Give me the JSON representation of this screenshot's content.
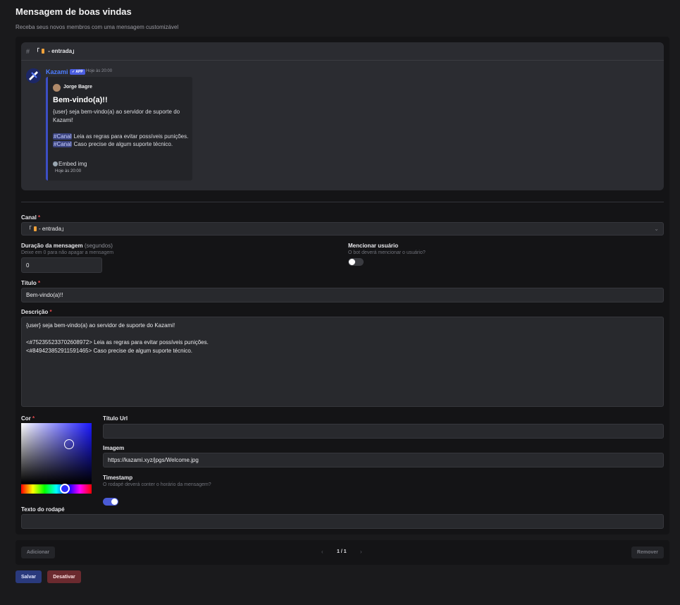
{
  "page": {
    "title": "Mensagem de boas vindas",
    "subtitle": "Receba seus novos membros com uma mensagem customizável"
  },
  "preview": {
    "channel_hash": "#",
    "channel_prefix": "「",
    "channel_name": " - entrada」",
    "bot_name": "Kazami",
    "app_badge": "✓ APP",
    "bot_time": "Hoje às 20:00",
    "embed": {
      "author": "Jorge Bagre",
      "title": "Bem-vindo(a)!!",
      "desc_line1": "{user} seja bem-vindo(a) ao servidor de suporte do Kazami!",
      "mention1": "#Canal",
      "line2_rest": " Leia as regras para evitar possíveis punições.",
      "mention2": "#Canal",
      "line3_rest": " Caso precise de algum suporte técnico.",
      "image_alt": "Embed img",
      "footer": "Hoje às 20:00"
    }
  },
  "form": {
    "canal_label": "Canal",
    "required_mark": "*",
    "canal_prefix": "「",
    "canal_value": " - entrada」",
    "duracao_label": "Duração da mensagem",
    "duracao_unit": "(segundos)",
    "duracao_hint": "Deixe em 0 para não apagar a mensagem",
    "duracao_value": "0",
    "mencionar_label": "Mencionar usuário",
    "mencionar_hint": "O bot deverá mencionar o usuário?",
    "mencionar_on": false,
    "titulo_label": "Título",
    "titulo_value": "Bem-vindo(a)!!",
    "descricao_label": "Descrição",
    "descricao_value": "{user} seja bem-vindo(a) ao servidor de suporte do Kazami!\n\n<#752355233702608972> Leia as regras para evitar possíveis punições.\n<#849423852911591465> Caso precise de algum suporte técnico.",
    "cor_label": "Cor",
    "cor_value": "#2a2cff",
    "titulo_url_label": "Título Url",
    "titulo_url_value": "",
    "imagem_label": "Imagem",
    "imagem_value": "https://kazami.xyz/jpgs/Welcome.jpg",
    "timestamp_label": "Timestamp",
    "timestamp_hint": "O rodapé deverá conter o horário da mensagem?",
    "timestamp_on": true,
    "rodape_label": "Texto do rodapé",
    "rodape_value": ""
  },
  "pager": {
    "add": "Adicionar",
    "prev": "‹",
    "page": "1 / 1",
    "next": "›",
    "remove": "Remover"
  },
  "actions": {
    "save": "Salvar",
    "disable": "Desativar"
  },
  "colors": {
    "accent": "#4a5bd6",
    "required": "#e5484d",
    "bot_name": "#4d7cff"
  }
}
